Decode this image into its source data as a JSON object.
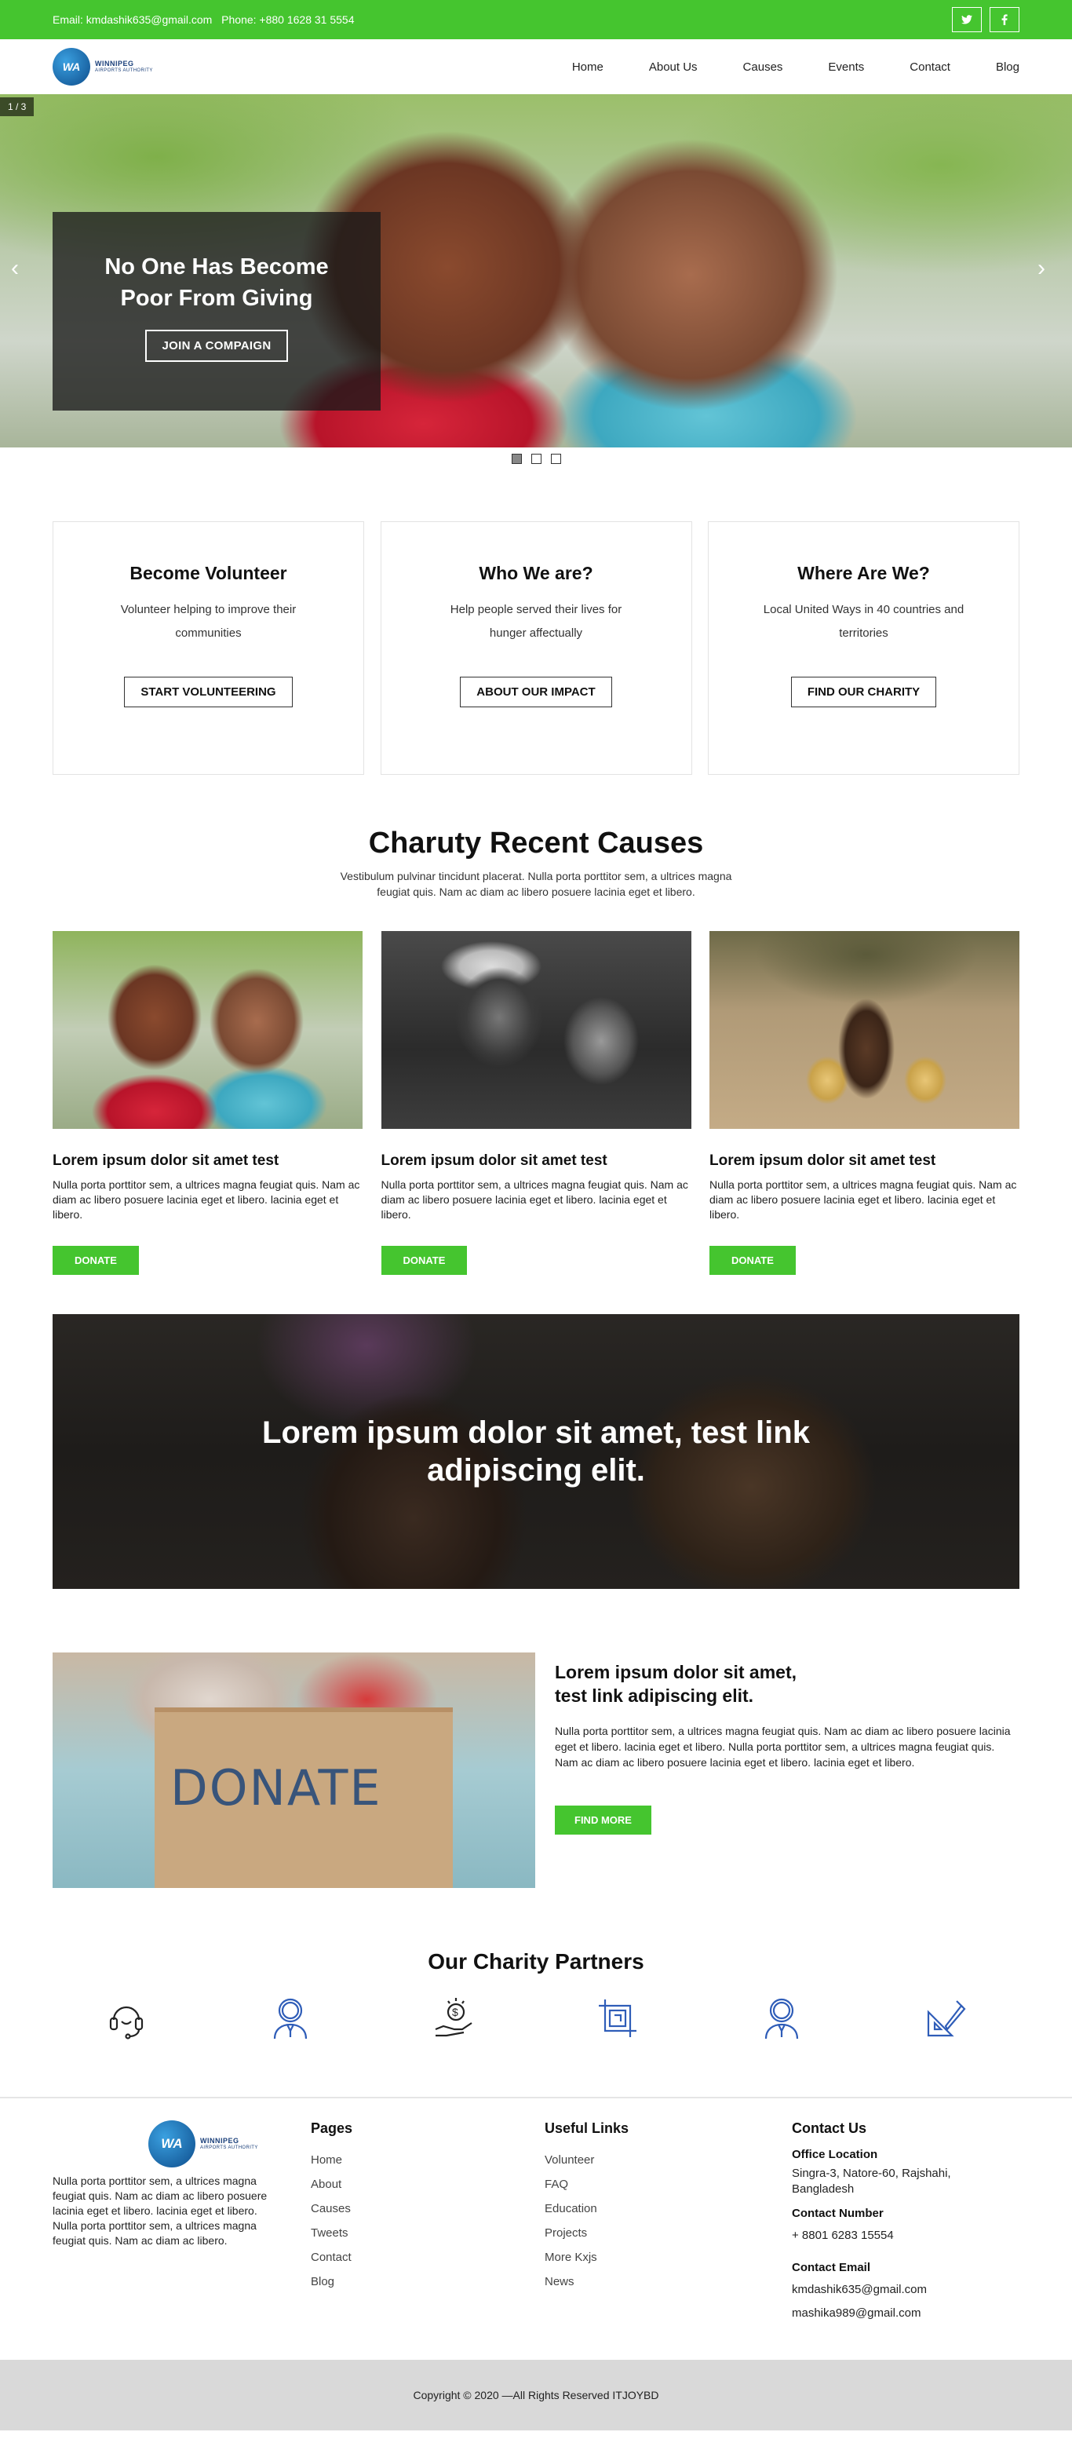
{
  "topbar": {
    "email": "Email: kmdashik635@gmail.com",
    "phone": "Phone: +880 1628 31 5554",
    "social": [
      "twitter-icon",
      "facebook-icon"
    ]
  },
  "brand": {
    "logo_text": "WA",
    "name": "WINNIPEG",
    "sub": "AIRPORTS AUTHORITY",
    "accent": "#45c52f"
  },
  "nav": [
    "Home",
    "About Us",
    "Causes",
    "Events",
    "Contact",
    "Blog"
  ],
  "hero": {
    "counter": "1 / 3",
    "title": "No One Has Become Poor From Giving",
    "button": "JOIN A COMPAIGN",
    "prev": "‹",
    "next": "›",
    "active_slide": 1,
    "slide_count": 3
  },
  "features": [
    {
      "title": "Become Volunteer",
      "text": "Volunteer helping to improve their communities",
      "button": "START VOLUNTEERING"
    },
    {
      "title": "Who We are?",
      "text": "Help people served their lives for hunger affectually",
      "button": "ABOUT OUR IMPACT"
    },
    {
      "title": "Where Are We?",
      "text": "Local United Ways in 40 countries and territories",
      "button": "FIND OUR CHARITY"
    }
  ],
  "causes": {
    "title": "Charuty Recent Causes",
    "subtitle": "Vestibulum pulvinar tincidunt placerat. Nulla porta porttitor sem, a ultrices magna feugiat quis. Nam ac diam ac libero posuere lacinia eget et libero.",
    "items": [
      {
        "title": "Lorem ipsum dolor sit amet test",
        "text": "Nulla porta porttitor sem, a ultrices magna feugiat quis. Nam ac diam ac libero posuere lacinia eget et libero. lacinia eget et libero.",
        "button": "DONATE"
      },
      {
        "title": "Lorem ipsum dolor sit amet test",
        "text": "Nulla porta porttitor sem, a ultrices magna feugiat quis. Nam ac diam ac libero posuere lacinia eget et libero. lacinia eget et libero.",
        "button": "DONATE"
      },
      {
        "title": "Lorem ipsum dolor sit amet test",
        "text": "Nulla porta porttitor sem, a ultrices magna feugiat quis. Nam ac diam ac libero posuere lacinia eget et libero. lacinia eget et libero.",
        "button": "DONATE"
      }
    ]
  },
  "banner": {
    "title": "Lorem ipsum dolor sit amet, test link adipiscing elit."
  },
  "about": {
    "image_text": "DONATE",
    "title": "Lorem ipsum dolor sit amet, test link adipiscing elit.",
    "text": "Nulla porta porttitor sem, a ultrices magna feugiat quis. Nam ac diam ac libero posuere lacinia eget et libero. lacinia eget et libero. Nulla porta porttitor sem, a ultrices magna feugiat quis. Nam ac diam ac libero posuere lacinia eget et libero. lacinia eget et libero.",
    "button": "FIND MORE"
  },
  "partners": {
    "title": "Our Charity Partners",
    "icons": [
      "headset-icon",
      "support-agent-icon",
      "dollar-hand-icon",
      "crop-tool-icon",
      "support-agent-icon",
      "design-tools-icon"
    ]
  },
  "footer": {
    "about_text": "Nulla porta porttitor sem, a ultrices magna feugiat quis. Nam ac diam ac libero posuere lacinia eget et libero. lacinia eget et libero. Nulla porta porttitor sem, a ultrices magna feugiat quis. Nam ac diam ac libero.",
    "pages": {
      "title": "Pages",
      "links": [
        "Home",
        "About",
        "Causes",
        "Tweets",
        "Contact",
        "Blog"
      ]
    },
    "useful": {
      "title": "Useful Links",
      "links": [
        "Volunteer",
        "FAQ",
        "Education",
        "Projects",
        "More Kxjs",
        "News"
      ]
    },
    "contact": {
      "title": "Contact Us",
      "office_label": "Office Location",
      "office": "Singra-3, Natore-60, Rajshahi, Bangladesh",
      "number_label": "Contact Number",
      "number": "+ 8801 6283 15554",
      "email_label": "Contact Email",
      "email1": "kmdashik635@gmail.com",
      "email2": "mashika989@gmail.com"
    },
    "copyright": "Copyright © 2020 —All Rights Reserved ITJOYBD"
  }
}
